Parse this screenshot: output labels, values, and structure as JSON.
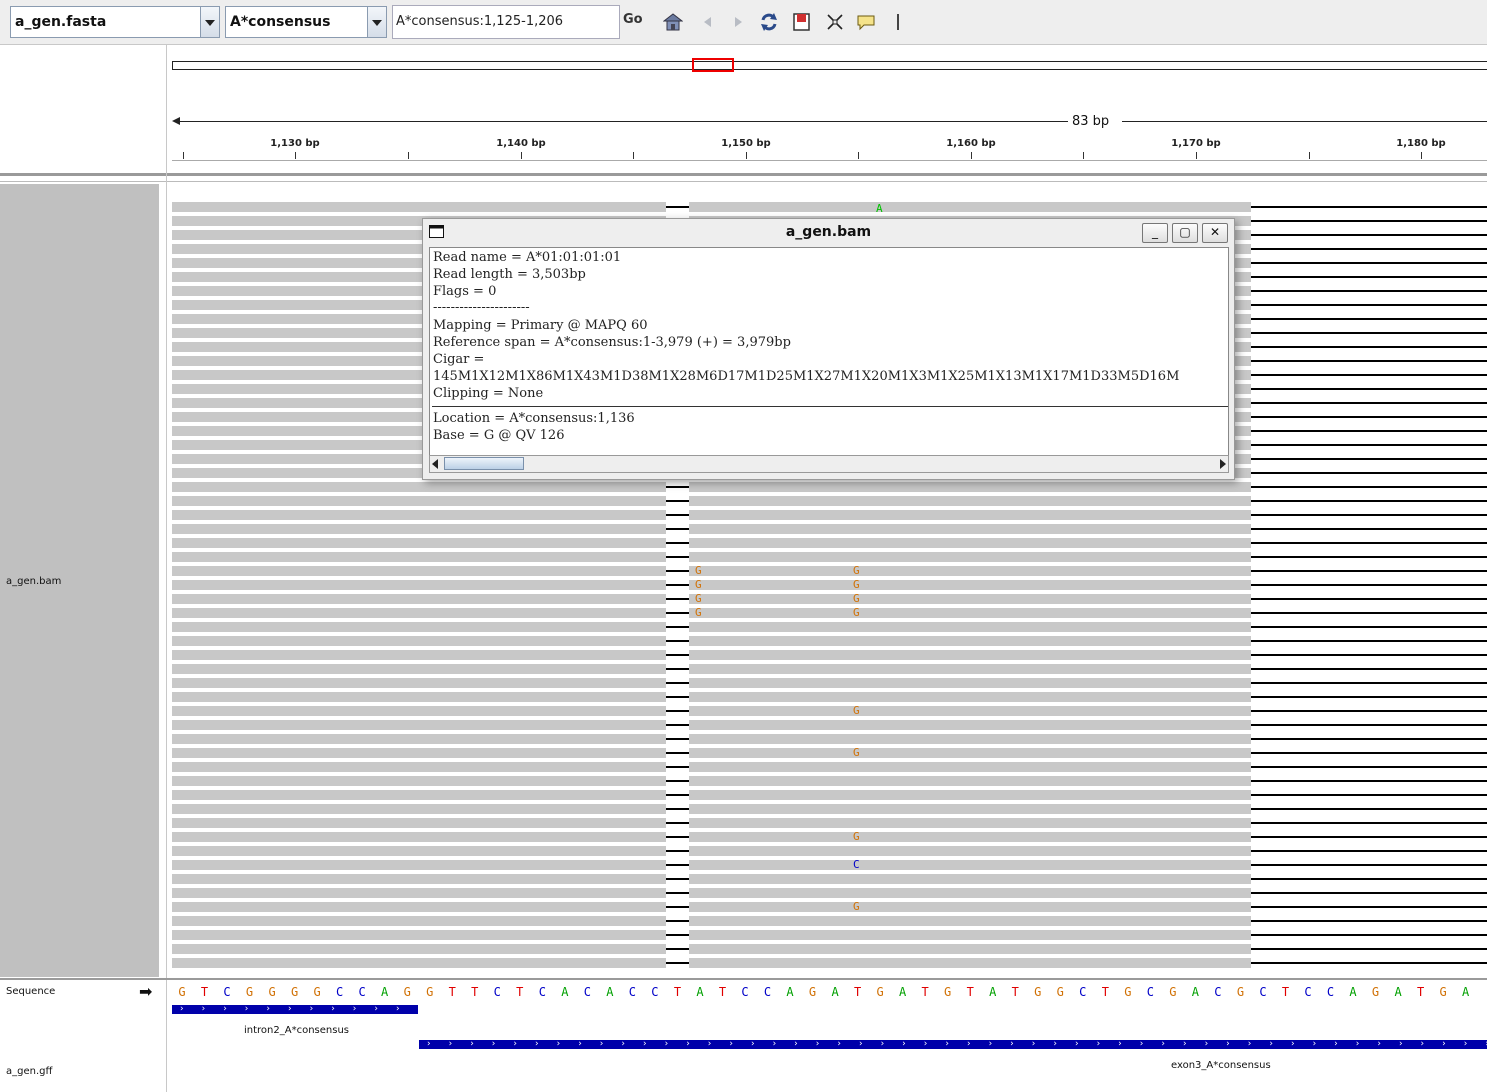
{
  "toolbar": {
    "genome": "a_gen.fasta",
    "chromosome": "A*consensus",
    "locus": "A*consensus:1,125-1,206",
    "go_label": "Go"
  },
  "ruler": {
    "span": "83 bp",
    "ticks": [
      "1,130 bp",
      "1,140 bp",
      "1,150 bp",
      "1,160 bp",
      "1,170 bp",
      "1,180 bp"
    ]
  },
  "tracks": {
    "bam": "a_gen.bam",
    "sequence": "Sequence",
    "gff": "a_gen.gff"
  },
  "top_mismatch": "A",
  "mismatches": [
    {
      "row": 26,
      "col": 0,
      "base": "G"
    },
    {
      "row": 26,
      "col": 1,
      "base": "G"
    },
    {
      "row": 27,
      "col": 0,
      "base": "G"
    },
    {
      "row": 27,
      "col": 1,
      "base": "G"
    },
    {
      "row": 28,
      "col": 0,
      "base": "G"
    },
    {
      "row": 28,
      "col": 1,
      "base": "G"
    },
    {
      "row": 29,
      "col": 0,
      "base": "G"
    },
    {
      "row": 29,
      "col": 1,
      "base": "G"
    },
    {
      "row": 36,
      "col": 1,
      "base": "G"
    },
    {
      "row": 39,
      "col": 1,
      "base": "G"
    },
    {
      "row": 45,
      "col": 1,
      "base": "G"
    },
    {
      "row": 47,
      "col": 1,
      "base": "C"
    },
    {
      "row": 50,
      "col": 1,
      "base": "G"
    }
  ],
  "sequence": "GTCGGGGCCAGGTTCTCACACCTATCCAGATGATGTATGGCTGCGACGCTCCAGATGAT",
  "base_colors": {
    "A": "#00a000",
    "C": "#0000c8",
    "G": "#d17105",
    "T": "#e00000"
  },
  "features": [
    {
      "label": "intron2_A*consensus"
    },
    {
      "label": "exon3_A*consensus"
    }
  ],
  "popup": {
    "title": "a_gen.bam",
    "lines": [
      "Read name = A*01:01:01:01",
      "Read length = 3,503bp",
      "Flags = 0",
      "----------------------",
      "Mapping = Primary @ MAPQ 60",
      "Reference span = A*consensus:1-3,979 (+) = 3,979bp",
      "Cigar =",
      "145M1X12M1X86M1X43M1D38M1X28M6D17M1D25M1X27M1X20M1X3M1X25M1X13M1X17M1D33M5D16M",
      "Clipping = None"
    ],
    "location_lines": [
      "Location = A*consensus:1,136",
      "Base = G @ QV 126"
    ]
  }
}
